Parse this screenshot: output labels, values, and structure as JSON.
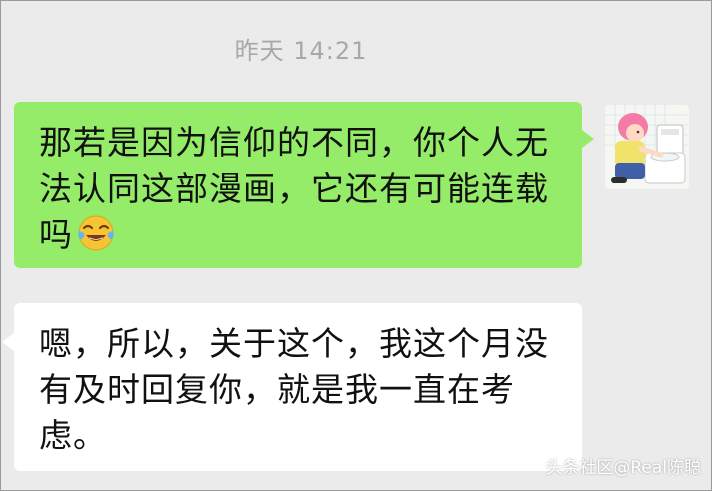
{
  "chat": {
    "timestamp": "昨天 14:21",
    "messages": [
      {
        "direction": "outgoing",
        "lines": [
          "那若是因为信仰的不同，你个人无",
          "法认同这部漫画，它还有可能连载",
          "吗"
        ],
        "emoji": "face-with-tears-of-joy-icon"
      },
      {
        "direction": "incoming",
        "lines": [
          "嗯，所以，关于这个，我这个月没",
          "有及时回复你，就是我一直在考",
          "虑。"
        ]
      }
    ]
  },
  "avatar": {
    "icon": "cartoon-person-avatar-icon"
  },
  "watermark": "头条社区@Real陈聪",
  "colors": {
    "background": "#ebebeb",
    "outgoing_bubble": "#95ec69",
    "incoming_bubble": "#ffffff",
    "timestamp_text": "#a8a8a8"
  }
}
